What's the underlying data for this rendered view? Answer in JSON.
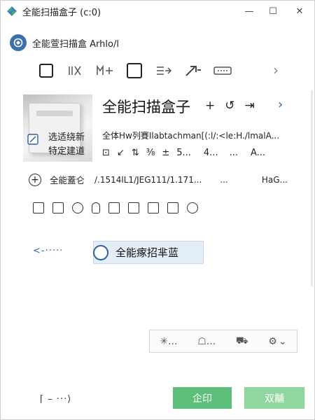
{
  "window": {
    "title": "全能扫描盒子 (c:0)",
    "controls": {
      "minimize": "—",
      "maximize": "☐",
      "close": "✕"
    }
  },
  "header": {
    "app_name": "全能萱扫描盒  Arhlo/l"
  },
  "toolbar": {
    "items": [
      "square-icon",
      "grid-icon",
      "layers-icon",
      "frame-icon",
      "export-icon",
      "pen-icon",
      "menu-icon"
    ],
    "more": "›"
  },
  "device": {
    "thumb_text_1": "选适绕新",
    "thumb_text_2": "特定建道",
    "title": "全能扫描盒子",
    "title_actions": [
      "+",
      "↺",
      "⇥"
    ],
    "next": "›",
    "info": "全体Hw列賽Ilabtachman[(:l/:<le:H./lmalA...",
    "icon_row": [
      "⊡",
      "↙",
      "⇅",
      "⅜",
      "±",
      "5...",
      "4...",
      "...",
      "A..."
    ]
  },
  "status": {
    "label": "全能蓋仑",
    "path": "/.1514lL1/JEG111/1.171...",
    "dots": "...",
    "size": "HaG..."
  },
  "small_icons": [
    "calendar-icon",
    "text-icon",
    "clock-icon",
    "hand-icon",
    "monitor-icon",
    "chart-icon",
    "list-icon",
    "home-icon",
    "gear-icon"
  ],
  "actions": {
    "back": "<-·····",
    "scan": "全能瘃招芈蓝"
  },
  "bottom_tools": {
    "items": [
      "✳...",
      "☖...",
      "⛟",
      "⚙"
    ],
    "caret": "⌄"
  },
  "footer": {
    "nav": "⌈ – ···⟩",
    "confirm": "企印",
    "cancel": "双黼"
  },
  "colors": {
    "accent": "#2d5fa8",
    "green": "#5dbf7a",
    "green_light": "#8fd79e",
    "scan_bg": "#e4eef9"
  }
}
